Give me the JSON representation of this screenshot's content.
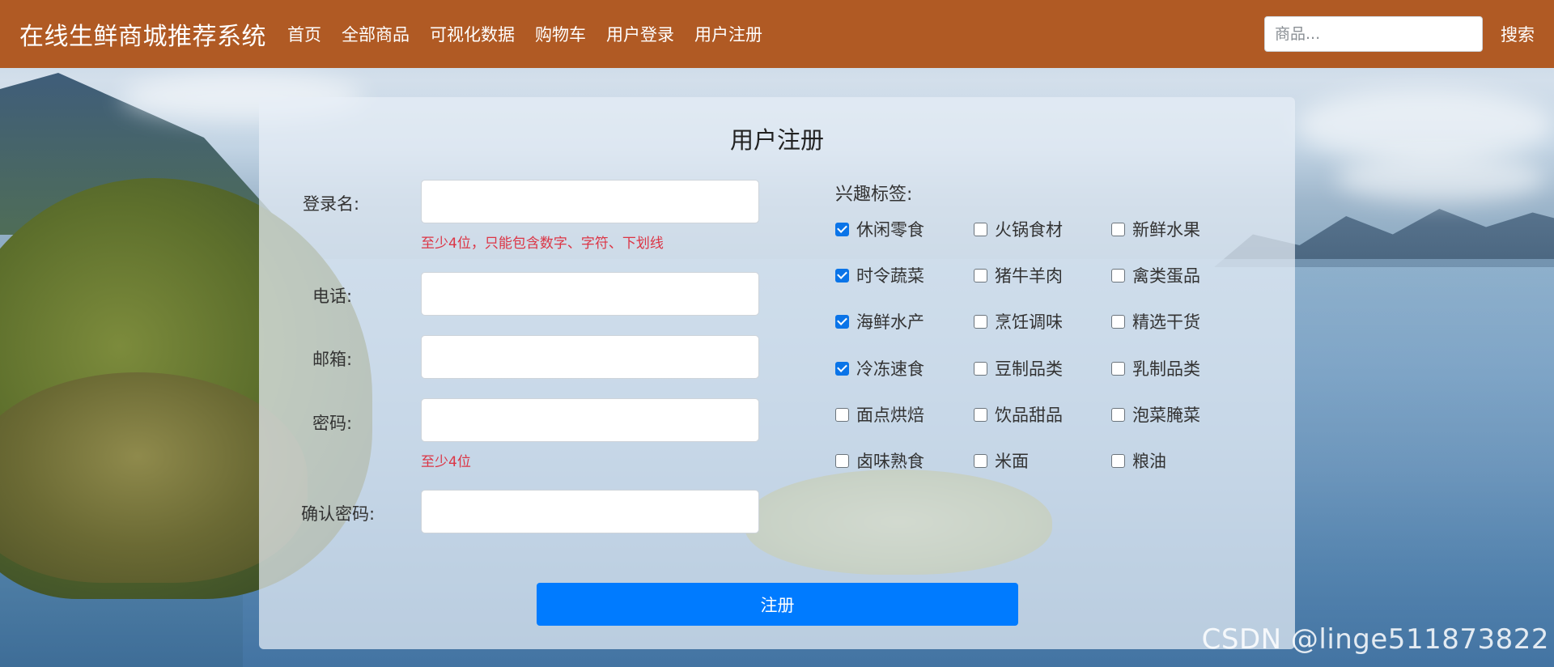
{
  "nav": {
    "brand": "在线生鲜商城推荐系统",
    "links": [
      "首页",
      "全部商品",
      "可视化数据",
      "购物车",
      "用户登录",
      "用户注册"
    ],
    "search_placeholder": "商品...",
    "search_label": "搜索"
  },
  "form": {
    "title": "用户注册",
    "fields": {
      "username": {
        "label": "登录名:",
        "value": "",
        "hint": "至少4位，只能包含数字、字符、下划线"
      },
      "phone": {
        "label": "电话:",
        "value": ""
      },
      "email": {
        "label": "邮箱:",
        "value": ""
      },
      "password": {
        "label": "密码:",
        "value": "",
        "hint": "至少4位"
      },
      "confirm": {
        "label": "确认密码:",
        "value": ""
      }
    },
    "tags_title": "兴趣标签:",
    "tags": [
      {
        "label": "休闲零食",
        "checked": true
      },
      {
        "label": "火锅食材",
        "checked": false
      },
      {
        "label": "新鲜水果",
        "checked": false
      },
      {
        "label": "时令蔬菜",
        "checked": true
      },
      {
        "label": "猪牛羊肉",
        "checked": false
      },
      {
        "label": "禽类蛋品",
        "checked": false
      },
      {
        "label": "海鲜水产",
        "checked": true
      },
      {
        "label": "烹饪调味",
        "checked": false
      },
      {
        "label": "精选干货",
        "checked": false
      },
      {
        "label": "冷冻速食",
        "checked": true
      },
      {
        "label": "豆制品类",
        "checked": false
      },
      {
        "label": "乳制品类",
        "checked": false
      },
      {
        "label": "面点烘焙",
        "checked": false
      },
      {
        "label": "饮品甜品",
        "checked": false
      },
      {
        "label": "泡菜腌菜",
        "checked": false
      },
      {
        "label": "卤味熟食",
        "checked": false
      },
      {
        "label": "米面",
        "checked": false
      },
      {
        "label": "粮油",
        "checked": false
      }
    ],
    "submit_label": "注册"
  },
  "watermark": "CSDN @linge511873822",
  "colors": {
    "navbar": "#b05a24",
    "primary": "#007bff",
    "hint": "#dc3545"
  }
}
